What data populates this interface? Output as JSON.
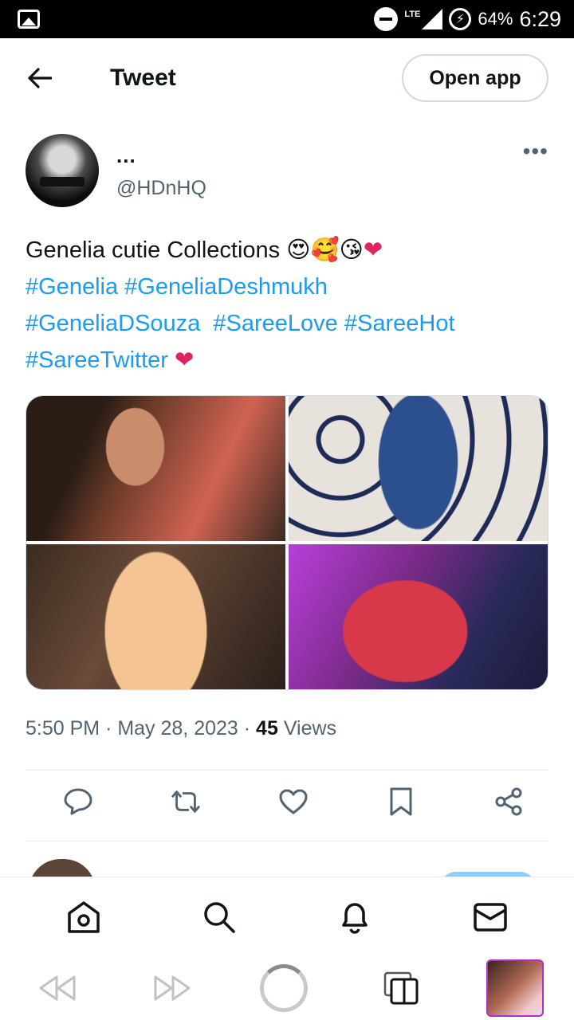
{
  "status_bar": {
    "network": "LTE",
    "battery": "64%",
    "time": "6:29"
  },
  "header": {
    "title": "Tweet",
    "open_app": "Open app"
  },
  "tweet": {
    "author_name": "...",
    "handle": "@HDnHQ",
    "text_plain": "Genelia cutie Collections ",
    "emojis": "😍🥰😘",
    "heart": "❤",
    "hashtags_line1": [
      "#Genelia",
      "#GeneliaDeshmukh"
    ],
    "hashtags_line2": [
      "#GeneliaDSouza",
      "#SareeLove",
      "#SareeHot"
    ],
    "hashtags_line3": [
      "#SareeTwitter"
    ],
    "time": "5:50 PM",
    "date": "May 28, 2023",
    "views_count": "45",
    "views_label": "Views"
  },
  "actions": [
    "reply",
    "retweet",
    "like",
    "bookmark",
    "share"
  ],
  "bottom_nav": [
    "home",
    "search",
    "notifications",
    "messages"
  ],
  "colors": {
    "link": "#1d9bf0",
    "text": "#0f1419",
    "muted": "#536471",
    "heart": "#e0245e"
  }
}
